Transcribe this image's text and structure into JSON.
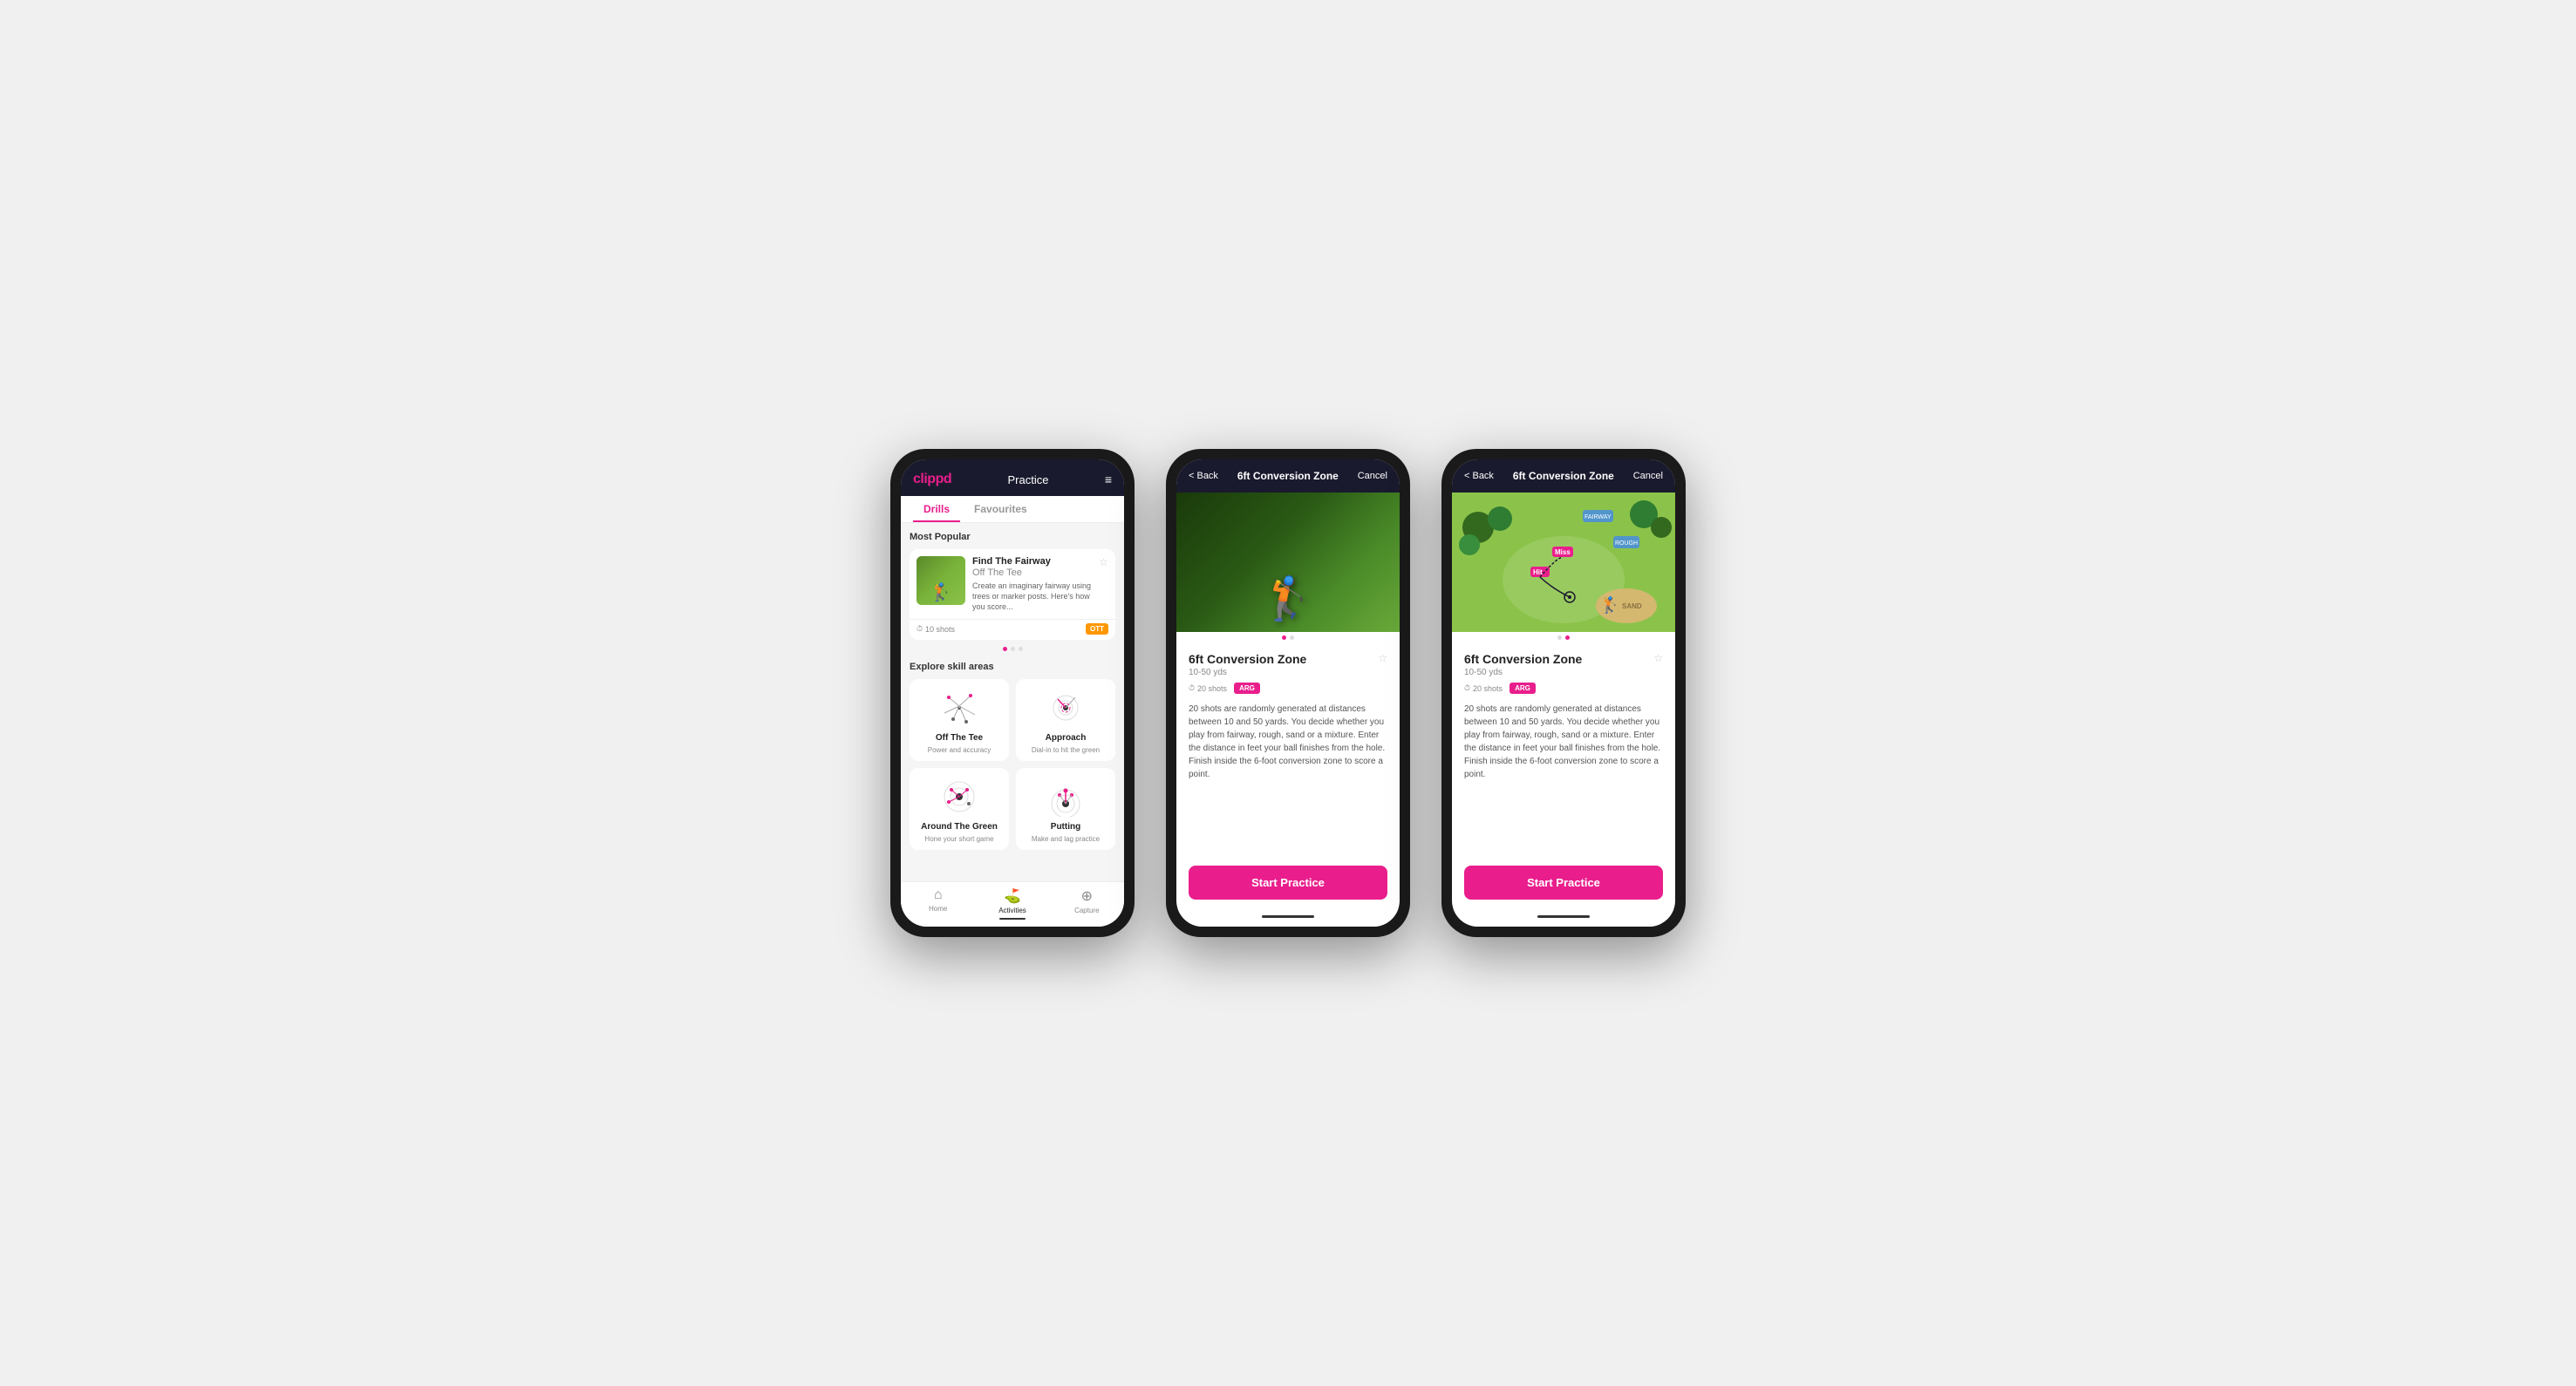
{
  "phones": {
    "phone1": {
      "header": {
        "logo": "clippd",
        "title": "Practice",
        "menu_icon": "≡"
      },
      "tabs": [
        {
          "label": "Drills",
          "active": true
        },
        {
          "label": "Favourites",
          "active": false
        }
      ],
      "most_popular_title": "Most Popular",
      "featured_drill": {
        "title": "Find The Fairway",
        "subtitle": "Off The Tee",
        "description": "Create an imaginary fairway using trees or marker posts. Here's how you score...",
        "shots": "10 shots",
        "badge": "OTT"
      },
      "explore_title": "Explore skill areas",
      "skill_areas": [
        {
          "title": "Off The Tee",
          "subtitle": "Power and accuracy"
        },
        {
          "title": "Approach",
          "subtitle": "Dial-in to hit the green"
        },
        {
          "title": "Around The Green",
          "subtitle": "Hone your short game"
        },
        {
          "title": "Putting",
          "subtitle": "Make and lag practice"
        }
      ],
      "nav": [
        {
          "label": "Home",
          "icon": "⌂",
          "active": false
        },
        {
          "label": "Activities",
          "icon": "⛳",
          "active": true
        },
        {
          "label": "Capture",
          "icon": "⊕",
          "active": false
        }
      ]
    },
    "phone2": {
      "header": {
        "back_label": "< Back",
        "title": "6ft Conversion Zone",
        "cancel_label": "Cancel"
      },
      "drill": {
        "title": "6ft Conversion Zone",
        "range": "10-50 yds",
        "shots": "20 shots",
        "badge": "ARG",
        "description": "20 shots are randomly generated at distances between 10 and 50 yards. You decide whether you play from fairway, rough, sand or a mixture. Enter the distance in feet your ball finishes from the hole. Finish inside the 6-foot conversion zone to score a point.",
        "start_button": "Start Practice",
        "image_type": "photo"
      }
    },
    "phone3": {
      "header": {
        "back_label": "< Back",
        "title": "6ft Conversion Zone",
        "cancel_label": "Cancel"
      },
      "drill": {
        "title": "6ft Conversion Zone",
        "range": "10-50 yds",
        "shots": "20 shots",
        "badge": "ARG",
        "description": "20 shots are randomly generated at distances between 10 and 50 yards. You decide whether you play from fairway, rough, sand or a mixture. Enter the distance in feet your ball finishes from the hole. Finish inside the 6-foot conversion zone to score a point.",
        "start_button": "Start Practice",
        "image_type": "map"
      }
    }
  }
}
